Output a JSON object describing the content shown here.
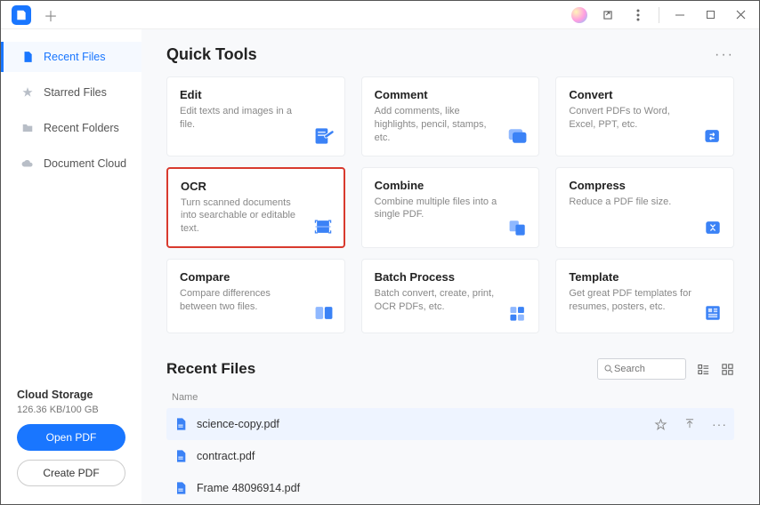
{
  "sidebar": {
    "items": [
      {
        "label": "Recent Files"
      },
      {
        "label": "Starred Files"
      },
      {
        "label": "Recent Folders"
      },
      {
        "label": "Document Cloud"
      }
    ],
    "storage_title": "Cloud Storage",
    "storage_sub": "126.36 KB/100 GB",
    "open_label": "Open PDF",
    "create_label": "Create PDF"
  },
  "quick_tools_title": "Quick Tools",
  "tools": [
    {
      "title": "Edit",
      "desc": "Edit texts and images in a file."
    },
    {
      "title": "Comment",
      "desc": "Add comments, like highlights, pencil, stamps, etc."
    },
    {
      "title": "Convert",
      "desc": "Convert PDFs to Word, Excel, PPT, etc."
    },
    {
      "title": "OCR",
      "desc": "Turn scanned documents into searchable or editable text."
    },
    {
      "title": "Combine",
      "desc": "Combine multiple files into a single PDF."
    },
    {
      "title": "Compress",
      "desc": "Reduce a PDF file size."
    },
    {
      "title": "Compare",
      "desc": "Compare differences between two files."
    },
    {
      "title": "Batch Process",
      "desc": "Batch convert, create, print, OCR PDFs, etc."
    },
    {
      "title": "Template",
      "desc": "Get great PDF templates for resumes, posters, etc."
    }
  ],
  "recent_files_title": "Recent Files",
  "search_placeholder": "Search",
  "col_name": "Name",
  "files": [
    {
      "name": "science-copy.pdf"
    },
    {
      "name": "contract.pdf"
    },
    {
      "name": "Frame 48096914.pdf"
    }
  ]
}
